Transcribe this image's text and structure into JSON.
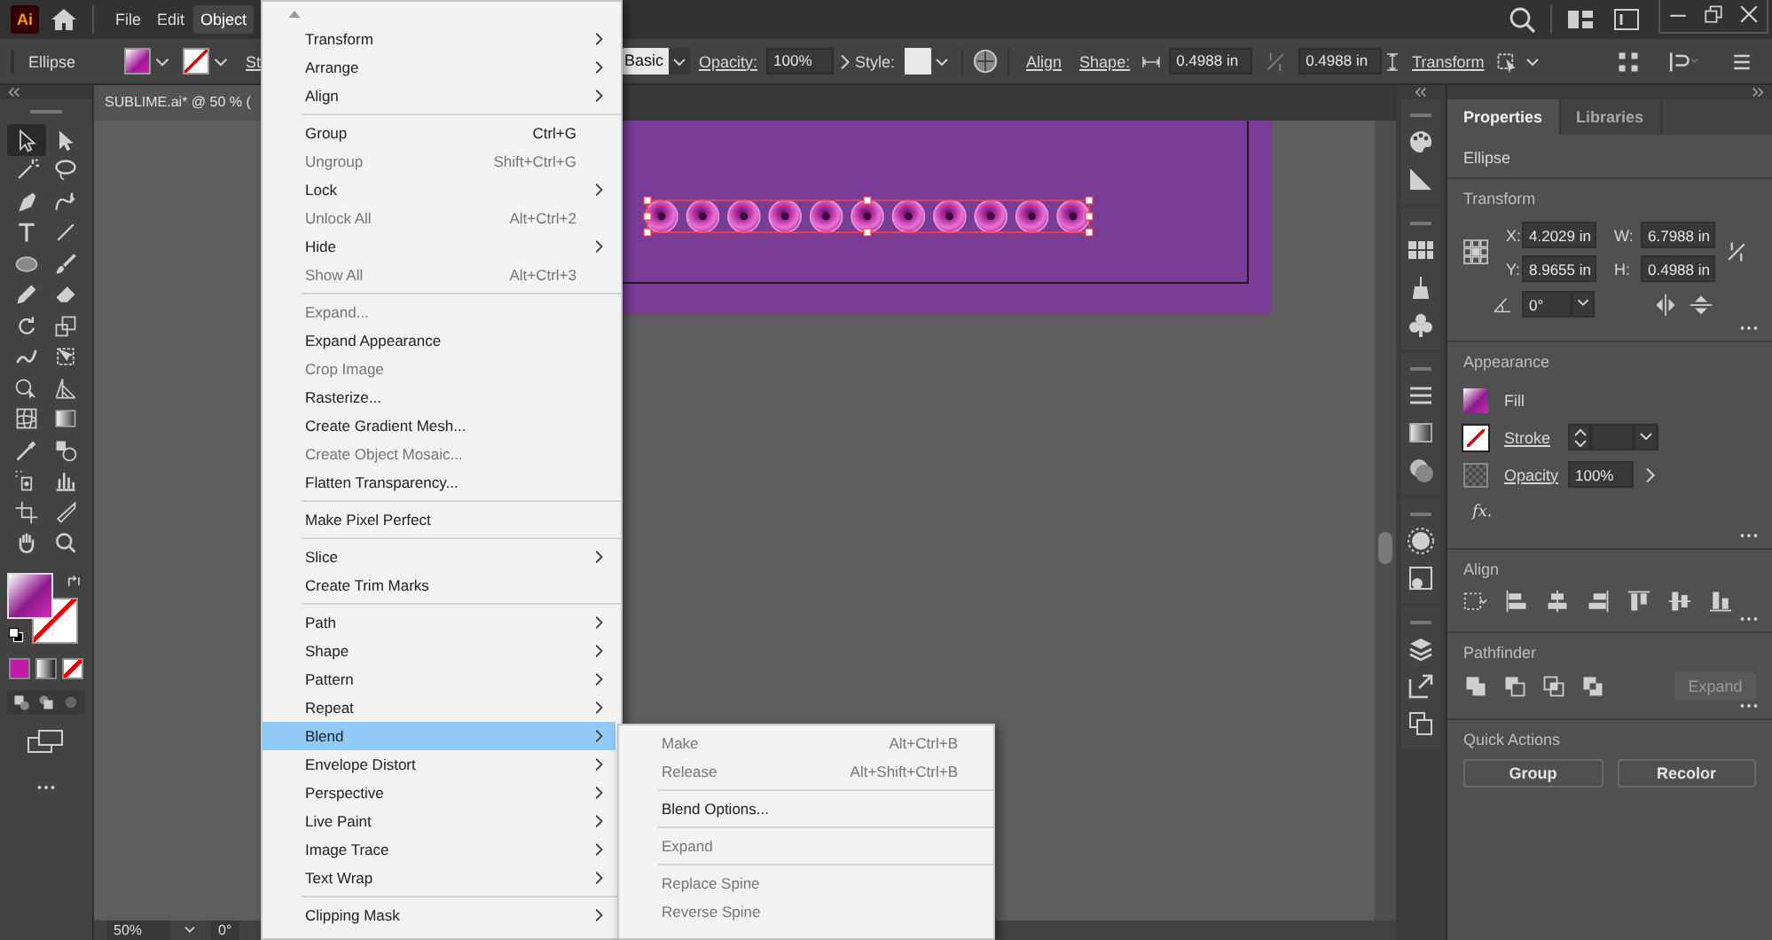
{
  "app_bar": {
    "logo": "Ai",
    "menus": [
      {
        "label": "File",
        "selected": false
      },
      {
        "label": "Edit",
        "selected": false
      },
      {
        "label": "Object",
        "selected": true
      }
    ]
  },
  "control_bar": {
    "object_type": "Ellipse",
    "stroke_label": "St",
    "brush": "Basic",
    "opacity_label": "Opacity:",
    "opacity": "100%",
    "style_label": "Style:",
    "align": "Align",
    "shape_label": "Shape:",
    "width": "0.4988 in",
    "height": "0.4988 in",
    "transform": "Transform"
  },
  "toolbox": {
    "tools": [
      {
        "selected": true
      },
      {
        "selected": false
      },
      {
        "selected": false
      },
      {
        "selected": false
      },
      {
        "selected": false
      },
      {
        "selected": false
      },
      {
        "selected": false
      },
      {
        "selected": false
      },
      {
        "selected": false
      },
      {
        "selected": false
      },
      {
        "selected": false
      },
      {
        "selected": false
      },
      {
        "selected": false
      },
      {
        "selected": false
      },
      {
        "selected": false
      },
      {
        "selected": false
      },
      {
        "selected": false
      },
      {
        "selected": false
      },
      {
        "selected": false
      },
      {
        "selected": false
      },
      {
        "selected": false
      },
      {
        "selected": false
      },
      {
        "selected": false
      },
      {
        "selected": false
      },
      {
        "selected": false
      },
      {
        "selected": false
      },
      {
        "selected": false
      },
      {
        "selected": false
      }
    ]
  },
  "document": {
    "tab_title": "SUBLIME.ai* @ 50 % ("
  },
  "status_bar": {
    "zoom": "50%",
    "rotation": "0°"
  },
  "properties_panel": {
    "tabs": [
      {
        "label": "Properties",
        "selected": true
      },
      {
        "label": "Libraries",
        "selected": false
      }
    ],
    "object_type": "Ellipse",
    "transform": {
      "title": "Transform",
      "fields": [
        {
          "label": "X:",
          "value": "4.2029 in"
        },
        {
          "label": "W:",
          "value": "6.7988 in"
        },
        {
          "label": "Y:",
          "value": "8.9655 in"
        },
        {
          "label": "H:",
          "value": "0.4988 in"
        }
      ],
      "angle": "0°"
    },
    "appearance": {
      "title": "Appearance",
      "fill": "Fill",
      "stroke": "Stroke",
      "opacity_label": "Opacity",
      "opacity": "100%",
      "fx": "fx."
    },
    "align": {
      "title": "Align"
    },
    "pathfinder": {
      "title": "Pathfinder",
      "expand": {
        "label": "Expand",
        "disabled": true
      }
    },
    "quick_actions": {
      "title": "Quick Actions",
      "buttons": [
        "Group",
        "Recolor"
      ]
    }
  },
  "object_menu": {
    "groups": [
      [
        {
          "label": "Transform",
          "submenu": true,
          "disabled": false,
          "selected": false
        },
        {
          "label": "Arrange",
          "submenu": true,
          "disabled": false,
          "selected": false
        },
        {
          "label": "Align",
          "submenu": true,
          "disabled": false,
          "selected": false
        }
      ],
      [
        {
          "label": "Group",
          "shortcut": "Ctrl+G",
          "submenu": false,
          "disabled": false,
          "selected": false
        },
        {
          "label": "Ungroup",
          "shortcut": "Shift+Ctrl+G",
          "submenu": false,
          "disabled": true,
          "selected": false
        },
        {
          "label": "Lock",
          "submenu": true,
          "disabled": false,
          "selected": false
        },
        {
          "label": "Unlock All",
          "shortcut": "Alt+Ctrl+2",
          "submenu": false,
          "disabled": true,
          "selected": false
        },
        {
          "label": "Hide",
          "submenu": true,
          "disabled": false,
          "selected": false
        },
        {
          "label": "Show All",
          "shortcut": "Alt+Ctrl+3",
          "submenu": false,
          "disabled": true,
          "selected": false
        }
      ],
      [
        {
          "label": "Expand...",
          "submenu": false,
          "disabled": true,
          "selected": false
        },
        {
          "label": "Expand Appearance",
          "submenu": false,
          "disabled": false,
          "selected": false
        },
        {
          "label": "Crop Image",
          "submenu": false,
          "disabled": true,
          "selected": false
        },
        {
          "label": "Rasterize...",
          "submenu": false,
          "disabled": false,
          "selected": false
        },
        {
          "label": "Create Gradient Mesh...",
          "submenu": false,
          "disabled": false,
          "selected": false
        },
        {
          "label": "Create Object Mosaic...",
          "submenu": false,
          "disabled": true,
          "selected": false
        },
        {
          "label": "Flatten Transparency...",
          "submenu": false,
          "disabled": false,
          "selected": false
        }
      ],
      [
        {
          "label": "Make Pixel Perfect",
          "submenu": false,
          "disabled": false,
          "selected": false
        }
      ],
      [
        {
          "label": "Slice",
          "submenu": true,
          "disabled": false,
          "selected": false
        },
        {
          "label": "Create Trim Marks",
          "submenu": false,
          "disabled": false,
          "selected": false
        }
      ],
      [
        {
          "label": "Path",
          "submenu": true,
          "disabled": false,
          "selected": false
        },
        {
          "label": "Shape",
          "submenu": true,
          "disabled": false,
          "selected": false
        },
        {
          "label": "Pattern",
          "submenu": true,
          "disabled": false,
          "selected": false
        },
        {
          "label": "Repeat",
          "submenu": true,
          "disabled": false,
          "selected": false
        },
        {
          "label": "Blend",
          "submenu": true,
          "disabled": false,
          "selected": true
        },
        {
          "label": "Envelope Distort",
          "submenu": true,
          "disabled": false,
          "selected": false
        },
        {
          "label": "Perspective",
          "submenu": true,
          "disabled": false,
          "selected": false
        },
        {
          "label": "Live Paint",
          "submenu": true,
          "disabled": false,
          "selected": false
        },
        {
          "label": "Image Trace",
          "submenu": true,
          "disabled": false,
          "selected": false
        },
        {
          "label": "Text Wrap",
          "submenu": true,
          "disabled": false,
          "selected": false
        }
      ],
      [
        {
          "label": "Clipping Mask",
          "submenu": true,
          "disabled": false,
          "selected": false
        }
      ]
    ]
  },
  "blend_submenu": {
    "groups": [
      [
        {
          "label": "Make",
          "shortcut": "Alt+Ctrl+B",
          "submenu": false,
          "disabled": true,
          "selected": false
        },
        {
          "label": "Release",
          "shortcut": "Alt+Shift+Ctrl+B",
          "submenu": false,
          "disabled": true,
          "selected": false
        }
      ],
      [
        {
          "label": "Blend Options...",
          "submenu": false,
          "disabled": false,
          "selected": false
        }
      ],
      [
        {
          "label": "Expand",
          "submenu": false,
          "disabled": true,
          "selected": false
        }
      ],
      [
        {
          "label": "Replace Spine",
          "submenu": false,
          "disabled": true,
          "selected": false
        },
        {
          "label": "Reverse Spine",
          "submenu": false,
          "disabled": true,
          "selected": false
        }
      ]
    ]
  }
}
